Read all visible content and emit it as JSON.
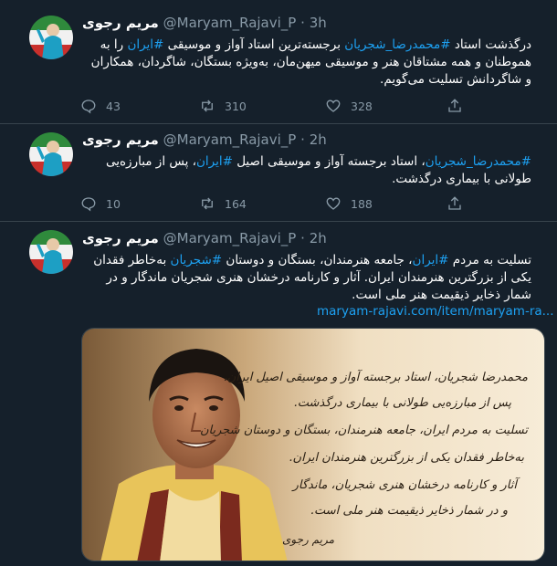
{
  "tweets": [
    {
      "name": "مریم رجوی",
      "handle": "@Maryam_Rajavi_P",
      "sep": "·",
      "time": "3h",
      "t1": "درگذشت استاد ",
      "tag1": "#محمدرضا_شجریان",
      "t2": " برجسته‌ترین استاد آواز و موسیقی ",
      "tag2": "#ایران",
      "t3": " را به هموطنان و همه مشتاقان هنر و موسیقی میهن‌مان، به‌ویژه بستگان، شاگردان، همکاران و شاگردانش تسلیت می‌گویم.",
      "replies": "43",
      "retweets": "310",
      "likes": "328"
    },
    {
      "name": "مریم رجوی",
      "handle": "@Maryam_Rajavi_P",
      "sep": "·",
      "time": "2h",
      "tag1": "#محمدرضا_شجریان",
      "t1": "، استاد برجسته آواز و موسیقی اصیل ",
      "tag2": "#ایران",
      "t2": "، پس از مبارزه‌یی طولانی با بیماری درگذشت.",
      "replies": "10",
      "retweets": "164",
      "likes": "188"
    },
    {
      "name": "مریم رجوی",
      "handle": "@Maryam_Rajavi_P",
      "sep": "·",
      "time": "2h",
      "t1": "تسلیت به مردم ",
      "tag1": "#ایران",
      "t2": "، جامعه هنرمندان، بستگان و دوستان ",
      "tag2": "#شجریان",
      "t3": " به‌خاطر فقدان یکی از بزرگترین هنرمندان ایران. آثار و کارنامه درخشان هنری شجریان ماندگار و در شمار ذخایر ذیقیمت هنر ملی است.",
      "link": "maryam-rajavi.com/item/maryam-ra..."
    }
  ],
  "calligraphy": [
    "محمدرضا شجریان، استاد برجسته آواز و موسیقی اصیل ایران،",
    "پس از مبارزه‌یی طولانی با بیماری درگذشت.",
    "تسلیت به مردم ایران، جامعه هنرمندان، بستگان و دوستان شجریان",
    "به‌خاطر فقدان یکی از بزرگترین هنرمندان ایران.",
    "آثار و کارنامه درخشان هنری شجریان، ماندگار",
    "و در شمار ذخایر ذیقیمت هنر ملی است."
  ],
  "signature": "مریم رجوی",
  "colors": {
    "background": "#15202b",
    "accent": "#1da1f2",
    "muted": "#8899a6",
    "divider": "#38444d"
  },
  "icons": [
    "reply-icon",
    "retweet-icon",
    "like-icon"
  ]
}
